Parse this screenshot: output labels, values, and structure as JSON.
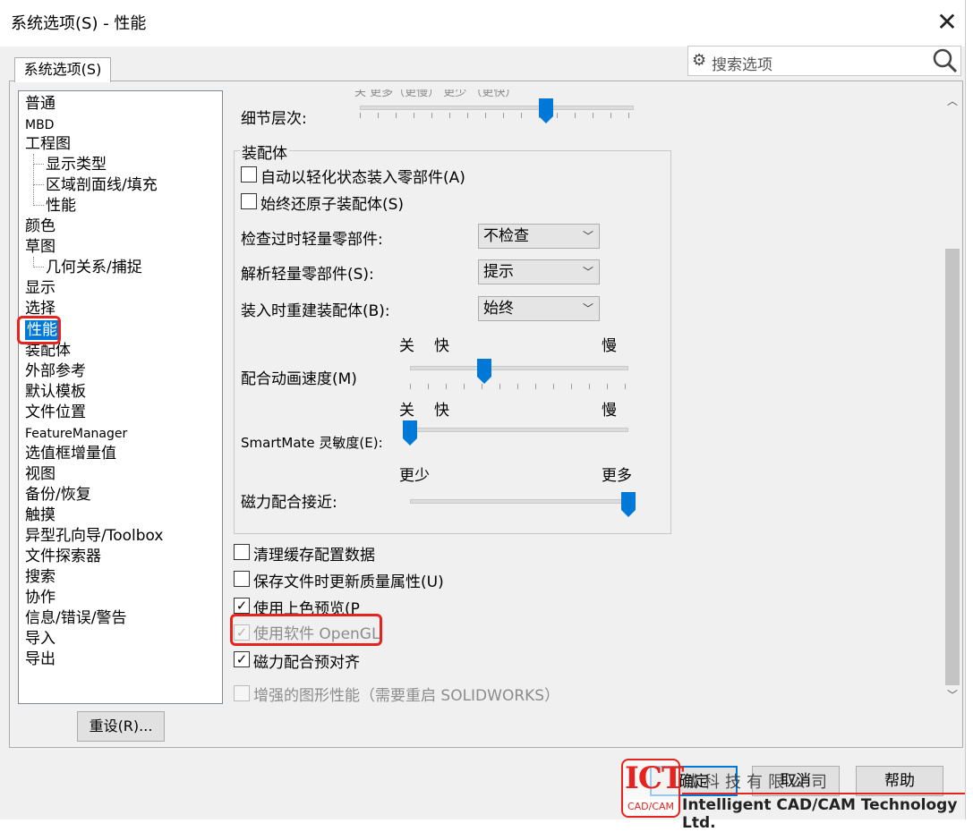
{
  "window": {
    "title": "系统选项(S) - 性能",
    "close_glyph": "✕"
  },
  "tab": {
    "label": "系统选项(S)"
  },
  "search": {
    "placeholder": "搜索选项"
  },
  "tree": {
    "items": [
      "普通",
      "MBD",
      "工程图",
      "显示类型",
      "区域剖面线/填充",
      "性能",
      "颜色",
      "草图",
      "几何关系/捕捉",
      "显示",
      "选择",
      "性能",
      "装配体",
      "外部参考",
      "默认模板",
      "文件位置",
      "FeatureManager",
      "选值框增量值",
      "视图",
      "备份/恢复",
      "触摸",
      "异型孔向导/Toolbox",
      "文件探索器",
      "搜索",
      "协作",
      "信息/错误/警告",
      "导入",
      "导出"
    ],
    "selected_index": 11
  },
  "reset_button": "重设(R)...",
  "panel": {
    "detail_level": {
      "label": "细节层次:",
      "partial_top_text": "关  更多（更慢）                            更少  （更快）",
      "level": 0.68
    },
    "assembly_group": {
      "title": "装配体",
      "checkbox_lightweight": {
        "label": "自动以轻化状态装入零部件(A)",
        "checked": false
      },
      "checkbox_resolve_sub": {
        "label": "始终还原子装配体(S)",
        "checked": false
      },
      "check_outdated": {
        "label": "检查过时轻量零部件:",
        "value": "不检查"
      },
      "resolve_lightweight": {
        "label": "解析轻量零部件(S):",
        "value": "提示"
      },
      "rebuild_on_load": {
        "label": "装入时重建装配体(B):",
        "value": "始终"
      },
      "mate_animation": {
        "label": "配合动画速度(M)",
        "off_label": "关",
        "fast_label": "快",
        "slow_label": "慢",
        "level": 0.34
      },
      "smartmate": {
        "label": "SmartMate 灵敏度(E):",
        "off_label": "关",
        "fast_label": "快",
        "slow_label": "慢",
        "level": 0.0
      },
      "magnetic_mate": {
        "label": "磁力配合接近:",
        "less_label": "更少",
        "more_label": "更多",
        "level": 1.0
      }
    },
    "checkboxes": [
      {
        "label": "清理缓存配置数据",
        "checked": false,
        "disabled": false
      },
      {
        "label": "保存文件时更新质量属性(U)",
        "checked": false,
        "disabled": false
      },
      {
        "label": "使用上色预览(P",
        "checked": true,
        "disabled": false
      },
      {
        "label": "使用软件 OpenGL",
        "checked": true,
        "disabled": true
      },
      {
        "label": "磁力配合预对齐",
        "checked": true,
        "disabled": false
      },
      {
        "label": "增强的图形性能（需要重启 SOLIDWORKS）",
        "checked": false,
        "disabled": true
      }
    ]
  },
  "buttons": {
    "ok": "确定",
    "cancel": "取消",
    "help": "帮助"
  },
  "watermark": {
    "logo_text": "ICT",
    "logo_sub": "CAD/CAM",
    "company_cn": "诚科技有限公司",
    "company_en": "Intelligent CAD/CAM Technology Ltd."
  },
  "colors": {
    "accent": "#0078d7",
    "highlight_box": "#e6231f"
  }
}
